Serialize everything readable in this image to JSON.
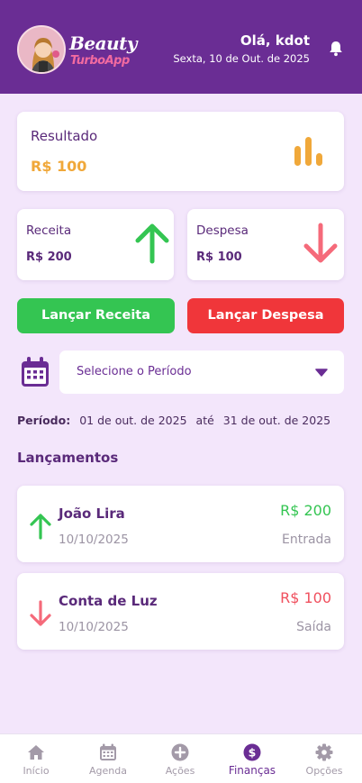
{
  "header": {
    "logo_top": "Beauty",
    "logo_bottom": "TurboApp",
    "greeting": "Olá, kdot",
    "date": "Sexta, 10 de Out. de 2025"
  },
  "summary": {
    "result_label": "Resultado",
    "result_value": "R$ 100",
    "income_label": "Receita",
    "income_value": "R$ 200",
    "expense_label": "Despesa",
    "expense_value": "R$ 100"
  },
  "actions": {
    "add_income": "Lançar Receita",
    "add_expense": "Lançar Despesa"
  },
  "filter": {
    "select_placeholder": "Selecione o Período",
    "period_label": "Período:",
    "from": "01 de out. de 2025",
    "until": "até",
    "to": "31 de out. de 2025"
  },
  "transactions": {
    "title": "Lançamentos",
    "items": [
      {
        "name": "João Lira",
        "date": "10/10/2025",
        "amount": "R$ 200",
        "type": "Entrada",
        "direction": "up"
      },
      {
        "name": "Conta de Luz",
        "date": "10/10/2025",
        "amount": "R$ 100",
        "type": "Saída",
        "direction": "down"
      }
    ]
  },
  "nav": {
    "items": [
      {
        "label": "Início",
        "icon": "home-icon"
      },
      {
        "label": "Agenda",
        "icon": "calendar-icon"
      },
      {
        "label": "Ações",
        "icon": "plus-circle-icon"
      },
      {
        "label": "Finanças",
        "icon": "dollar-circle-icon",
        "active": true
      },
      {
        "label": "Opções",
        "icon": "gear-icon"
      }
    ]
  },
  "colors": {
    "primary": "#6a2d94",
    "background": "#f3e6fb",
    "income_green": "#34c552",
    "expense_red": "#f0363a",
    "result_orange": "#f0a83a"
  }
}
